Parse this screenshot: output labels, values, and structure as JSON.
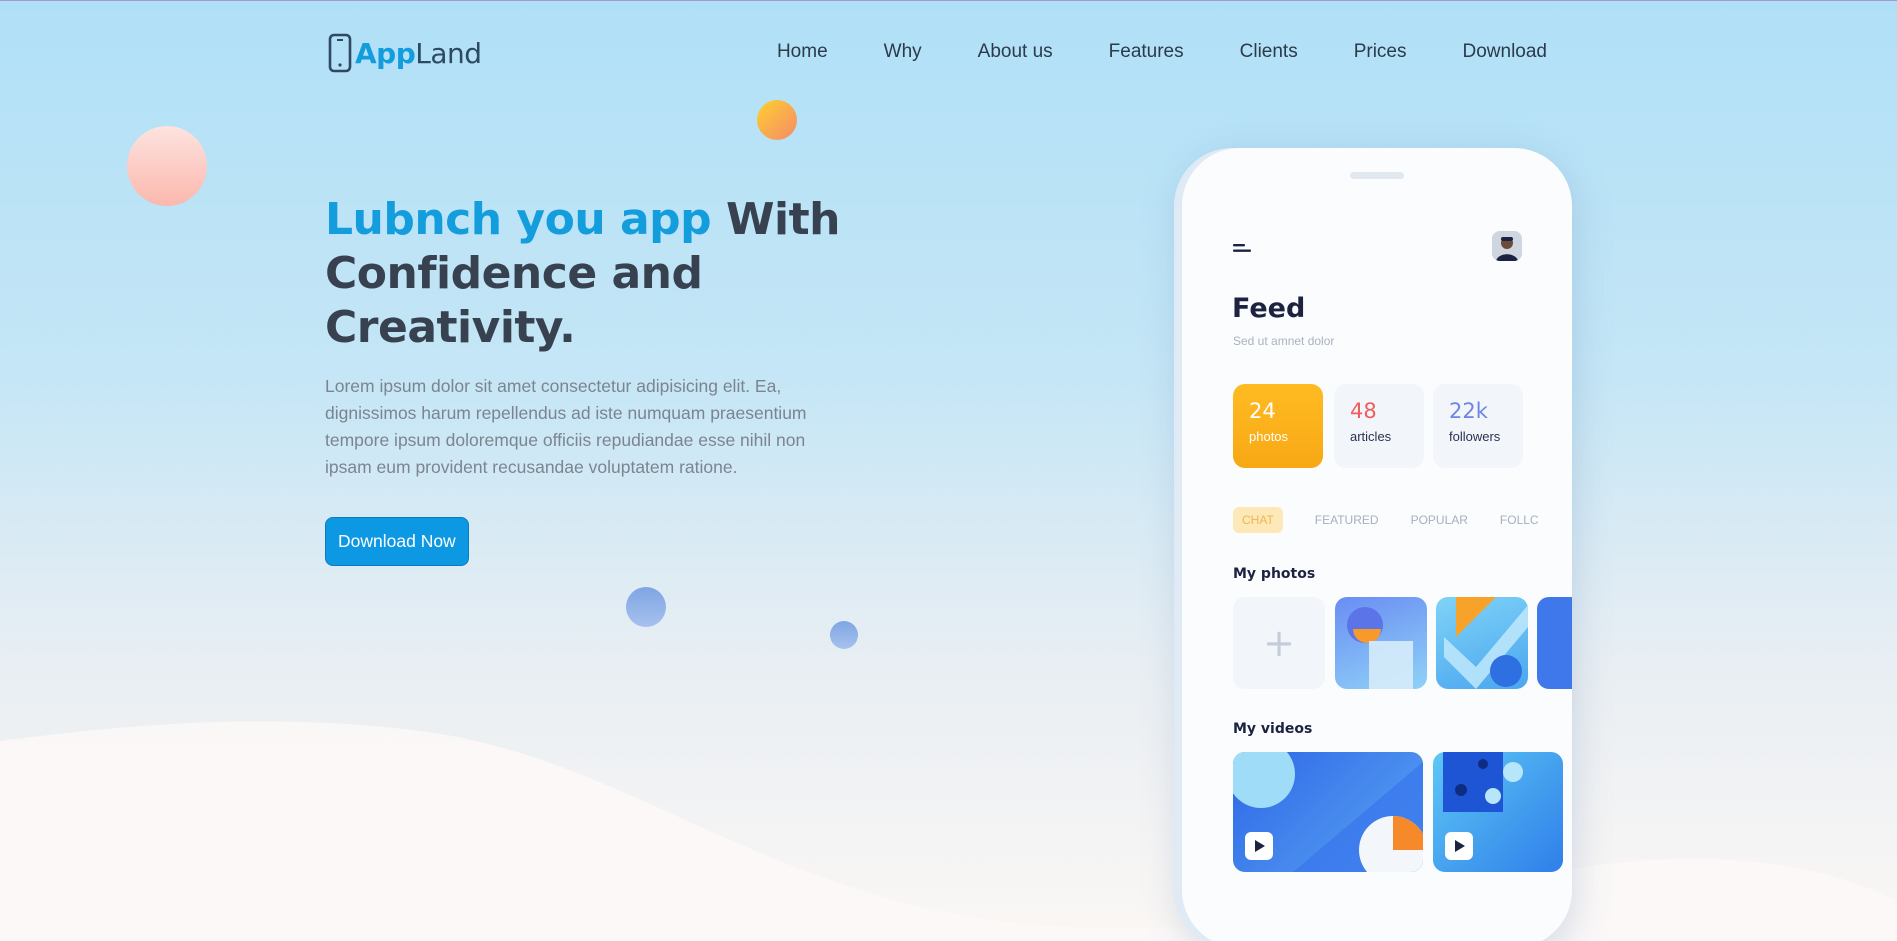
{
  "brand": {
    "logo_part1": "App",
    "logo_part2": "Land"
  },
  "nav": {
    "items": [
      {
        "label": "Home"
      },
      {
        "label": "Why"
      },
      {
        "label": "About us"
      },
      {
        "label": "Features"
      },
      {
        "label": "Clients"
      },
      {
        "label": "Prices"
      },
      {
        "label": "Download"
      }
    ]
  },
  "hero": {
    "title_accent": "Lubnch you app",
    "title_rest": " With Confidence and Creativity.",
    "description": "Lorem ipsum dolor sit amet consectetur adipisicing elit. Ea, dignissimos harum repellendus ad iste numquam praesentium tempore ipsum doloremque officiis repudiandae esse nihil non ipsam eum provident recusandae voluptatem ratione.",
    "cta_label": "Download Now"
  },
  "phone": {
    "title": "Feed",
    "subtitle": "Sed ut amnet dolor",
    "stats": [
      {
        "value": "24",
        "label": "photos"
      },
      {
        "value": "48",
        "label": "articles"
      },
      {
        "value": "22k",
        "label": "followers"
      }
    ],
    "tabs": [
      "CHAT",
      "FEATURED",
      "POPULAR",
      "FOLLC"
    ],
    "photos_heading": "My photos",
    "add_symbol": "+",
    "videos_heading": "My videos"
  },
  "colors": {
    "accent": "#149ddd",
    "heading": "#37414f",
    "button": "#0d98e3",
    "stat_orange": "#ffbb22"
  },
  "icons": [
    "phone-logo-icon",
    "menu-icon",
    "play-icon",
    "plus-icon"
  ]
}
